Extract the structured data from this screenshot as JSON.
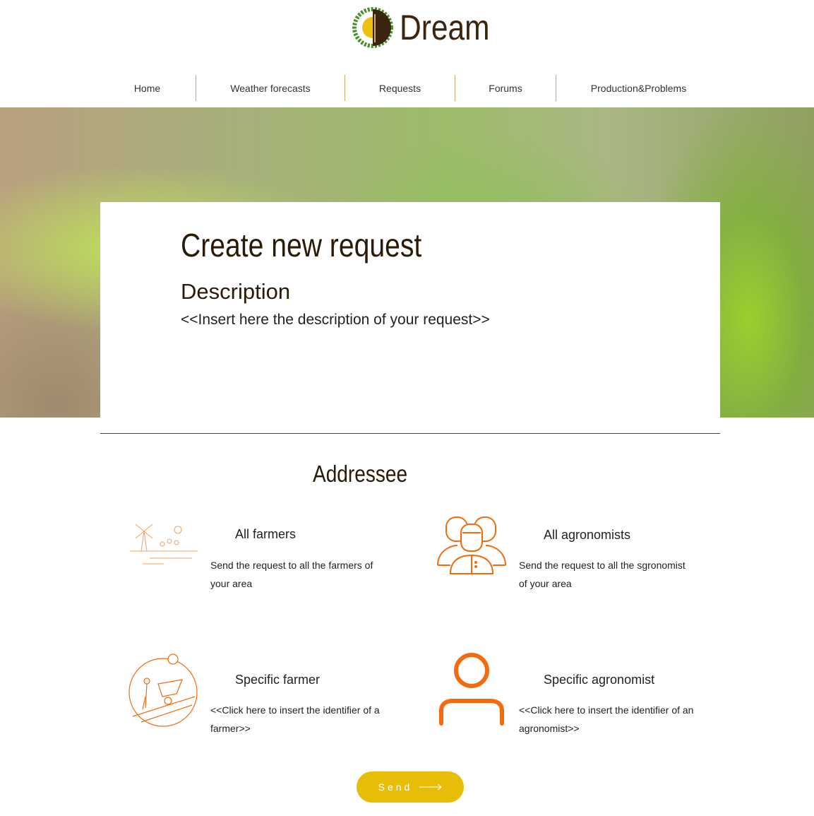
{
  "brand": {
    "name": "Dream"
  },
  "nav": [
    {
      "label": "Home"
    },
    {
      "label": "Weather forecasts"
    },
    {
      "label": "Requests"
    },
    {
      "label": "Forums"
    },
    {
      "label": "Production&Problems"
    }
  ],
  "form": {
    "title": "Create new request",
    "description_label": "Description",
    "description_placeholder": "<<Insert here the description of your request>>"
  },
  "addressee": {
    "heading": "Addressee",
    "options": [
      {
        "title": "All farmers",
        "text": "Send the request to all the farmers of your area"
      },
      {
        "title": "All agronomists",
        "text": "Send the request to all the sgronomist of your area"
      },
      {
        "title": "Specific farmer",
        "text": "<<Click here to insert the identifier of a farmer>>"
      },
      {
        "title": "Specific agronomist",
        "text": "<<Click here to insert the identifier of an agronomist>>"
      }
    ]
  },
  "send_label": "Send",
  "colors": {
    "accent": "#e8bd07",
    "icon": "#f26b0f",
    "text": "#2a1a08"
  }
}
